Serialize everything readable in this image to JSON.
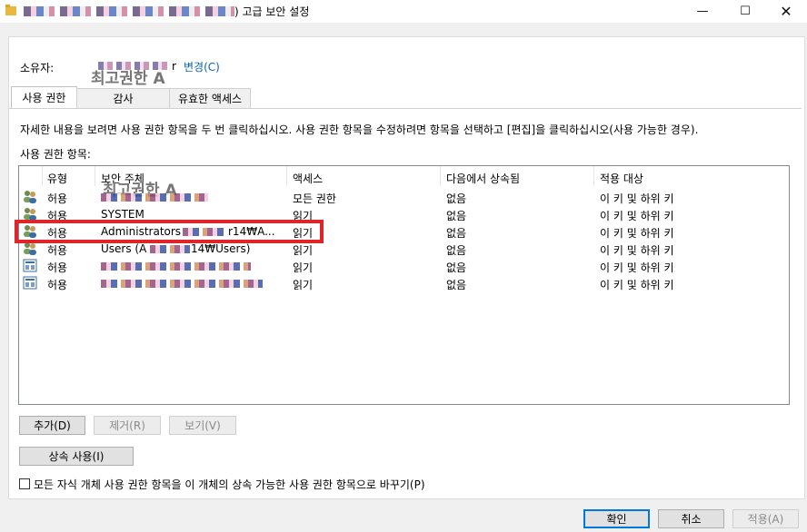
{
  "window": {
    "title_suffix": ") 고급 보안 설정",
    "minimize": "—",
    "maximize": "☐",
    "close": "✕"
  },
  "owner": {
    "label": "소유자:",
    "value_tail": "r",
    "overlay": "최고권한 A",
    "change_link": "변경(C)"
  },
  "tabs": [
    "사용 권한",
    "감사",
    "유효한 액세스"
  ],
  "description": "자세한 내용을 보려면 사용 권한 항목을 두 번 클릭하십시오. 사용 권한 항목을 수정하려면 항목을 선택하고 [편집]을 클릭하십시오(사용 가능한 경우).",
  "entries_label": "사용 권한 항목:",
  "columns": [
    "유형",
    "보안 주체",
    "액세스",
    "다음에서 상속됨",
    "적용 대상"
  ],
  "overlay_list": "최고권한 A",
  "rows": [
    {
      "type": "허용",
      "principal": "",
      "access": "모든 권한",
      "inherited": "없음",
      "applies": "이 키 및 하위 키",
      "icon": "users-icon"
    },
    {
      "type": "허용",
      "principal": "SYSTEM",
      "access": "읽기",
      "inherited": "없음",
      "applies": "이 키 및 하위 키",
      "icon": "users-icon"
    },
    {
      "type": "허용",
      "principal": "Administrators",
      "principal_tail": "r14₩A...",
      "access": "읽기",
      "inherited": "없음",
      "applies": "이 키 및 하위 키",
      "icon": "users-icon"
    },
    {
      "type": "허용",
      "principal": "Users (A",
      "principal_tail": "14₩Users)",
      "access": "읽기",
      "inherited": "없음",
      "applies": "이 키 및 하위 키",
      "icon": "users-icon"
    },
    {
      "type": "허용",
      "principal": "",
      "access": "읽기",
      "inherited": "없음",
      "applies": "이 키 및 하위 키",
      "icon": "app-icon"
    },
    {
      "type": "허용",
      "principal": "",
      "access": "읽기",
      "inherited": "없음",
      "applies": "이 키 및 하위 키",
      "icon": "app-icon"
    }
  ],
  "buttons": {
    "add": "추가(D)",
    "remove": "제거(R)",
    "view": "보기(V)",
    "inherit": "상속 사용(I)",
    "ok": "확인",
    "cancel": "취소",
    "apply": "적용(A)"
  },
  "replace_checkbox": "모든 자식 개체 사용 권한 항목을 이 개체의 상속 가능한 사용 권한 항목으로 바꾸기(P)"
}
